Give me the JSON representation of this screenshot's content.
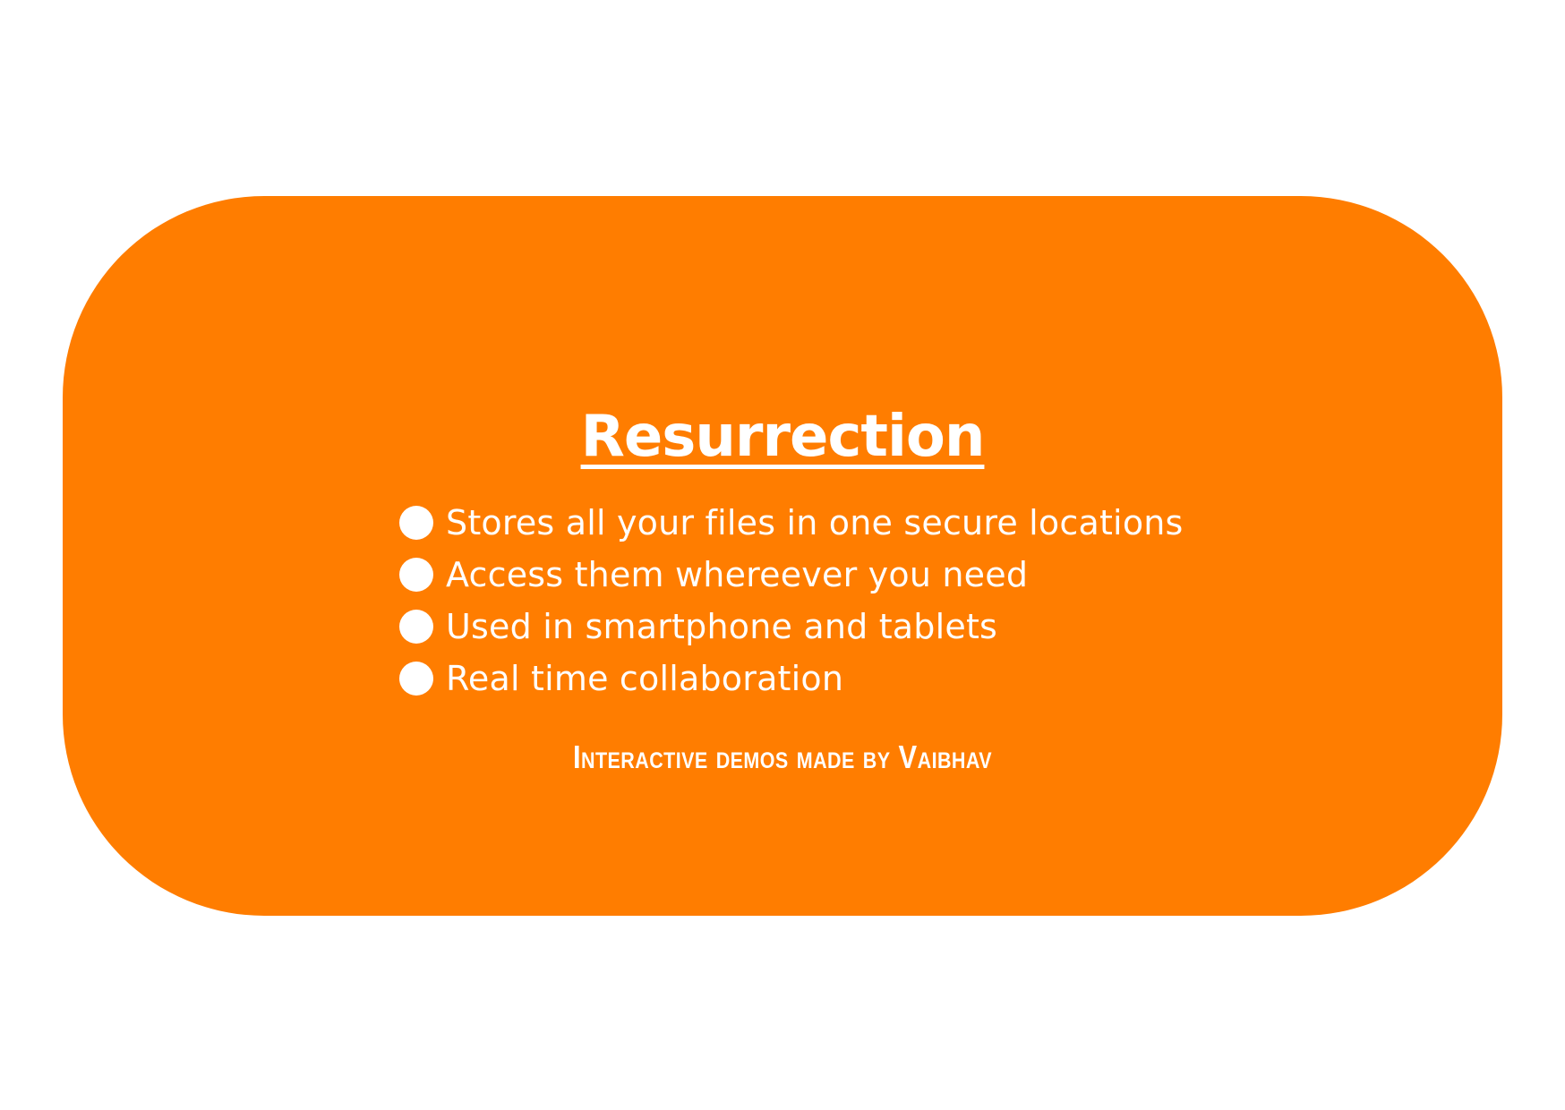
{
  "card": {
    "background_color": "#ff7d00",
    "text_color": "#ffffff",
    "title": "Resurrection",
    "features": [
      "Stores all your files in one secure locations",
      "Access them whereever you need",
      "Used in smartphone and tablets",
      "Real time collaboration"
    ],
    "credit": "Interactive demos made by Vaibhav"
  }
}
